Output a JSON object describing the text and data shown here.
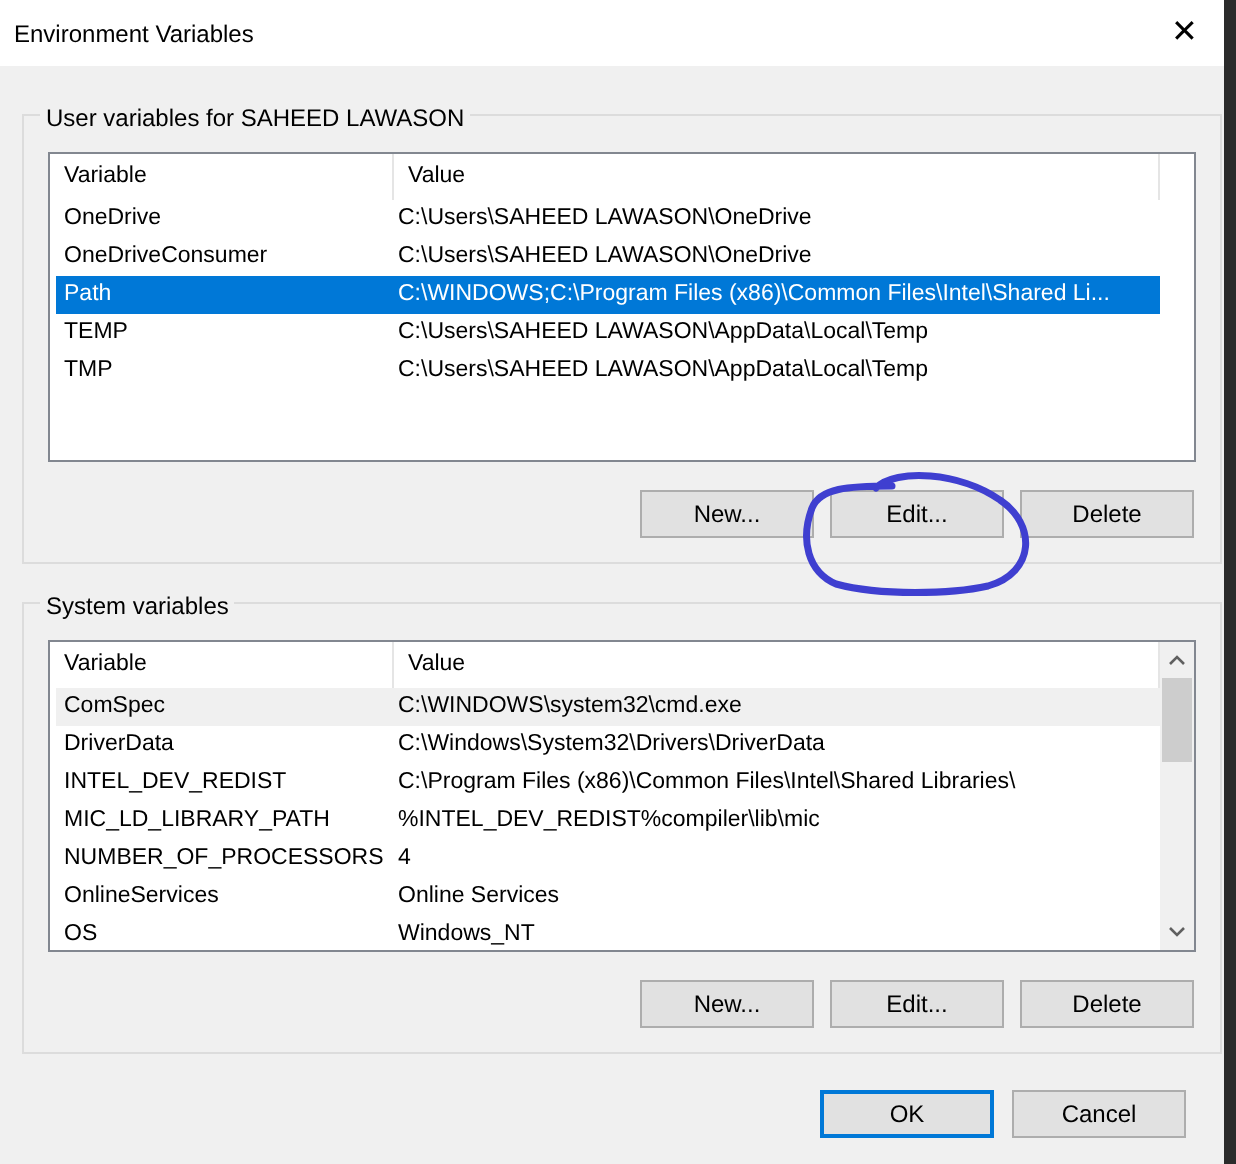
{
  "window": {
    "title": "Environment Variables",
    "close": "✕"
  },
  "user_group": {
    "title": "User variables for SAHEED LAWASON",
    "columns": [
      "Variable",
      "Value"
    ],
    "rows": [
      {
        "variable": "OneDrive",
        "value": "C:\\Users\\SAHEED LAWASON\\OneDrive",
        "selected": false
      },
      {
        "variable": "OneDriveConsumer",
        "value": "C:\\Users\\SAHEED LAWASON\\OneDrive",
        "selected": false
      },
      {
        "variable": "Path",
        "value": "C:\\WINDOWS;C:\\Program Files (x86)\\Common Files\\Intel\\Shared Li...",
        "selected": true
      },
      {
        "variable": "TEMP",
        "value": "C:\\Users\\SAHEED LAWASON\\AppData\\Local\\Temp",
        "selected": false
      },
      {
        "variable": "TMP",
        "value": "C:\\Users\\SAHEED LAWASON\\AppData\\Local\\Temp",
        "selected": false
      }
    ],
    "buttons": [
      "New...",
      "Edit...",
      "Delete"
    ]
  },
  "system_group": {
    "title": "System variables",
    "columns": [
      "Variable",
      "Value"
    ],
    "rows": [
      {
        "variable": "ComSpec",
        "value": "C:\\WINDOWS\\system32\\cmd.exe",
        "hovered": true
      },
      {
        "variable": "DriverData",
        "value": "C:\\Windows\\System32\\Drivers\\DriverData",
        "hovered": false
      },
      {
        "variable": "INTEL_DEV_REDIST",
        "value": "C:\\Program Files (x86)\\Common Files\\Intel\\Shared Libraries\\",
        "hovered": false
      },
      {
        "variable": "MIC_LD_LIBRARY_PATH",
        "value": "%INTEL_DEV_REDIST%compiler\\lib\\mic",
        "hovered": false
      },
      {
        "variable": "NUMBER_OF_PROCESSORS",
        "value": "4",
        "hovered": false
      },
      {
        "variable": "OnlineServices",
        "value": "Online Services",
        "hovered": false
      },
      {
        "variable": "OS",
        "value": "Windows_NT",
        "hovered": false
      }
    ],
    "buttons": [
      "New...",
      "Edit...",
      "Delete"
    ]
  },
  "dialog_buttons": [
    {
      "label": "OK",
      "default": true
    },
    {
      "label": "Cancel",
      "default": false
    }
  ],
  "annotation": {
    "kind": "freehand-circle",
    "color": "#3f3fd0"
  }
}
